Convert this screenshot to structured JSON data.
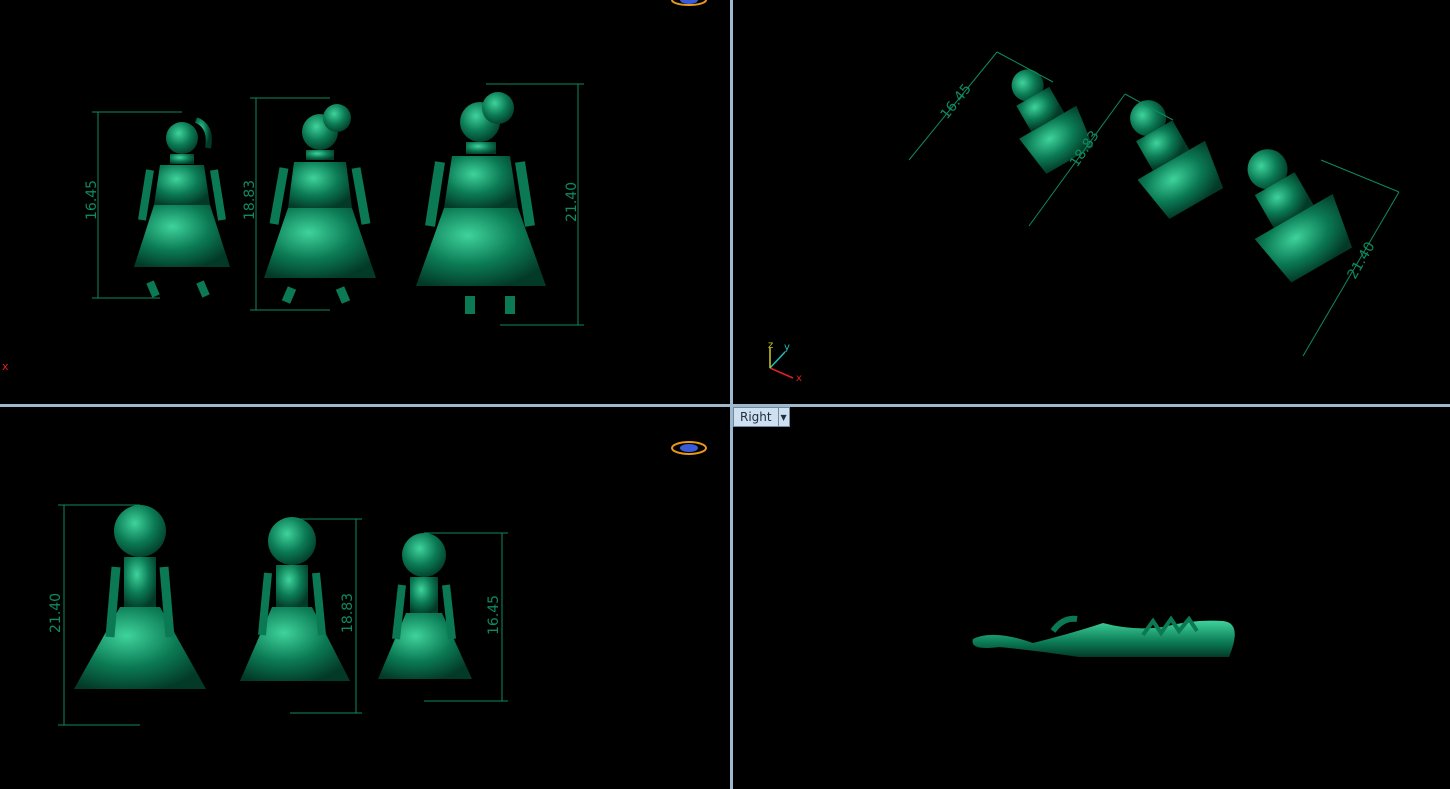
{
  "viewports": {
    "top": {
      "dimensions": [
        "16.45",
        "18.83",
        "21.40"
      ],
      "axis_x": "x"
    },
    "perspective": {
      "dimensions": [
        "16.45",
        "18.83",
        "21.40"
      ],
      "axis": {
        "x": "x",
        "y": "y",
        "z": "z"
      }
    },
    "front": {
      "dimensions": [
        "21.40",
        "18.83",
        "16.45"
      ]
    },
    "right": {
      "label": "Right"
    }
  },
  "colors": {
    "model": "#0b7a54",
    "dimension": "#0f8a5e",
    "divider": "#9fb8cc",
    "background": "#000000"
  }
}
